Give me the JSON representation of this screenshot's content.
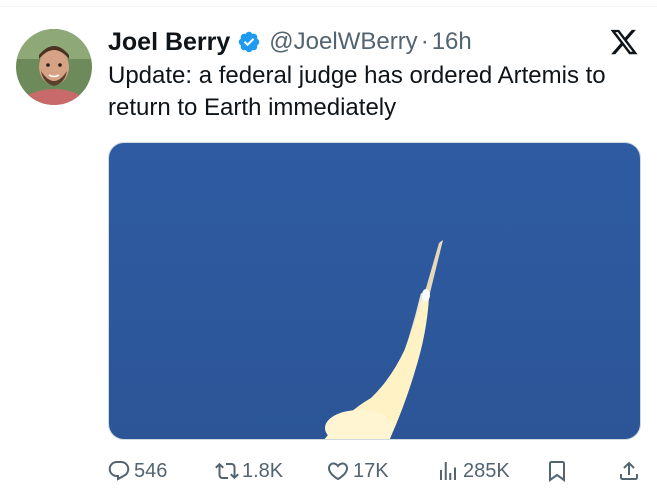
{
  "tweet": {
    "author": {
      "display_name": "Joel Berry",
      "handle": "@JoelWBerry",
      "verified": true
    },
    "separator": "·",
    "time": "16h",
    "text": "Update: a federal judge has ordered Artemis to return to Earth immediately"
  },
  "stats": {
    "replies": "546",
    "reposts": "1.8K",
    "likes": "17K",
    "views": "285K"
  },
  "colors": {
    "verified_badge": "#1d9bf0",
    "secondary_text": "#536471",
    "media_sky": "#2e5aa0"
  },
  "icons": {
    "verified": "verified-badge-icon",
    "brand": "x-logo-icon",
    "reply": "reply-icon",
    "repost": "repost-icon",
    "like": "heart-icon",
    "views": "views-chart-icon",
    "bookmark": "bookmark-icon",
    "share": "share-icon"
  }
}
